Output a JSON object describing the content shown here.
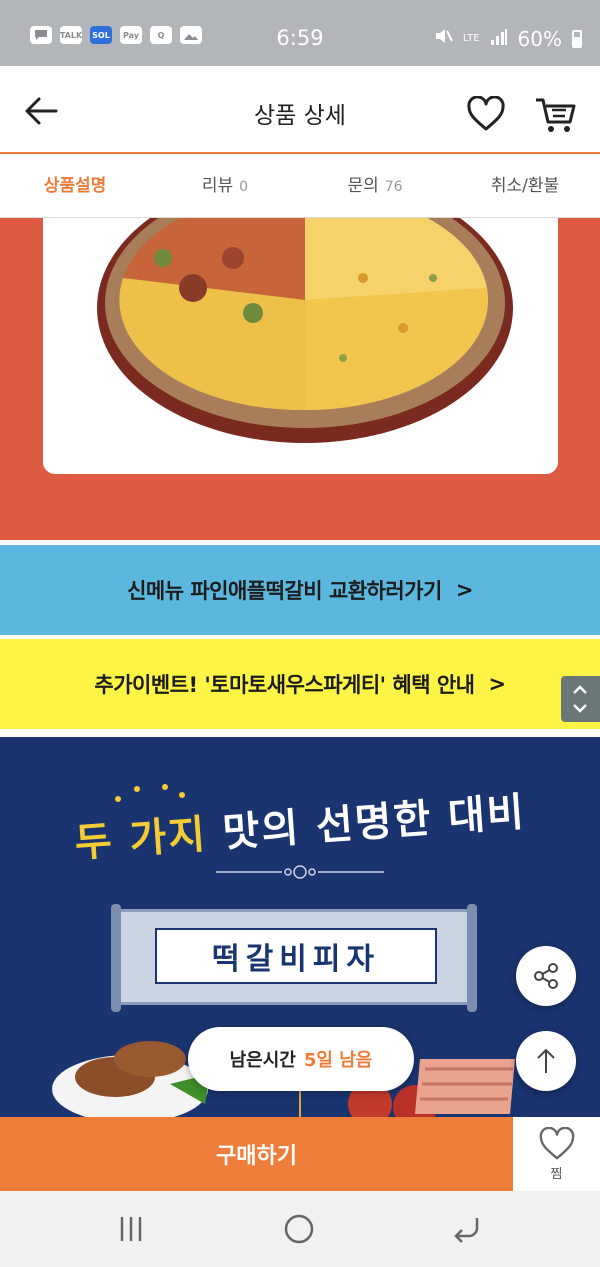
{
  "status_bar": {
    "time": "6:59",
    "battery": "60%",
    "network": "LTE",
    "notification_icons": [
      "message-icon",
      "talk-icon",
      "sol-icon",
      "pay-icon",
      "q-icon",
      "gallery-icon"
    ],
    "talk_label": "TALK",
    "sol_label": "SOL",
    "pay_label": "Pay",
    "q_label": "Q"
  },
  "header": {
    "title": "상품 상세"
  },
  "tabs": [
    {
      "label": "상품설명",
      "count": "",
      "active": true
    },
    {
      "label": "리뷰",
      "count": "0",
      "active": false
    },
    {
      "label": "문의",
      "count": "76",
      "active": false
    },
    {
      "label": "취소/환불",
      "count": "",
      "active": false
    }
  ],
  "banners": {
    "blue_text": "신메뉴 파인애플떡갈비 교환하러가기",
    "blue_arrow": ">",
    "yellow_text": "추가이벤트! '토마토새우스파게티' 혜택 안내",
    "yellow_arrow": ">"
  },
  "promo": {
    "headline_yellow": "두 가지",
    "headline_white": "맛의 선명한 대비",
    "scroll_title": "떡갈비피자"
  },
  "remaining": {
    "label": "남은시간",
    "value": "5일 남음"
  },
  "bottom_bar": {
    "buy_label": "구매하기",
    "wish_label": "찜"
  },
  "colors": {
    "accent": "#ef7d3a",
    "promo_navy": "#1a3470",
    "banner_blue": "#5bb7dd",
    "banner_yellow": "#fdf445",
    "pizza_bg": "#dd5a43"
  }
}
